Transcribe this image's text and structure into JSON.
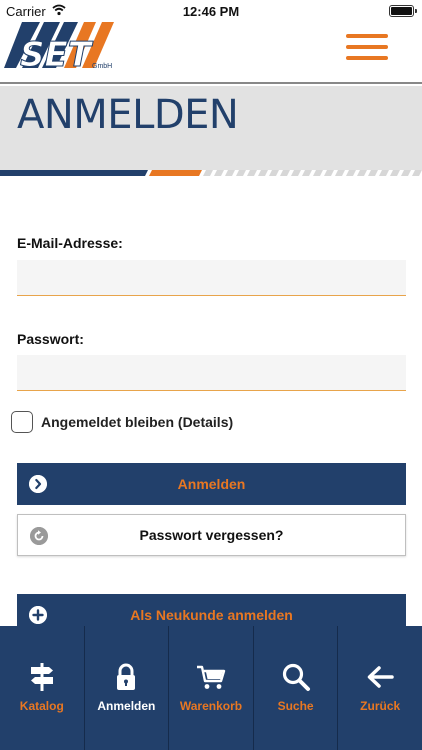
{
  "status_bar": {
    "carrier": "Carrier",
    "time": "12:46 PM"
  },
  "header": {
    "logo_text": "SET",
    "logo_subtext": "GmbH"
  },
  "page": {
    "title": "ANMELDEN"
  },
  "form": {
    "email_label": "E-Mail-Adresse:",
    "email_value": "",
    "password_label": "Passwort:",
    "password_value": "",
    "remember_label": "Angemeldet bleiben (Details)",
    "remember_checked": false,
    "login_button": "Anmelden",
    "forgot_button": "Passwort vergessen?",
    "register_button": "Als Neukunde anmelden"
  },
  "tab_bar": {
    "tabs": [
      {
        "label": "Katalog",
        "icon": "signpost-icon"
      },
      {
        "label": "Anmelden",
        "icon": "lock-icon",
        "active": true
      },
      {
        "label": "Warenkorb",
        "icon": "cart-icon"
      },
      {
        "label": "Suche",
        "icon": "search-icon"
      },
      {
        "label": "Zurück",
        "icon": "back-arrow-icon"
      }
    ]
  },
  "colors": {
    "navy": "#22406b",
    "orange": "#e87722",
    "band_gray": "#e2e2e2"
  }
}
